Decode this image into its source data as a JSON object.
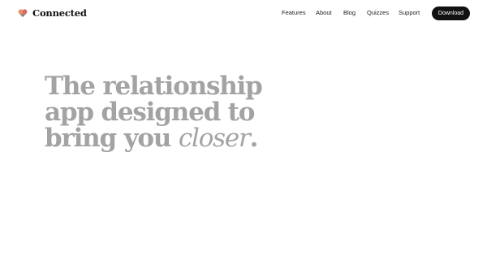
{
  "brand": {
    "icon": "heart-logo-icon",
    "name": "Connected"
  },
  "nav": {
    "links": [
      {
        "label": "Features"
      },
      {
        "label": "About"
      },
      {
        "label": "Blog"
      },
      {
        "label": "Quizzes"
      },
      {
        "label": "Support"
      }
    ],
    "download_label": "Download"
  },
  "hero": {
    "line1": "The relationship",
    "line2": "app designed to",
    "line3_prefix": "bring you ",
    "line3_emphasis": "closer",
    "line3_suffix": "."
  },
  "colors": {
    "heading": "#a3a3a3",
    "button_bg": "#111111",
    "button_text": "#ffffff",
    "logo_top_left": "#e9925f",
    "logo_top_right": "#d96a6a",
    "logo_bottom": "#5e8f86"
  }
}
